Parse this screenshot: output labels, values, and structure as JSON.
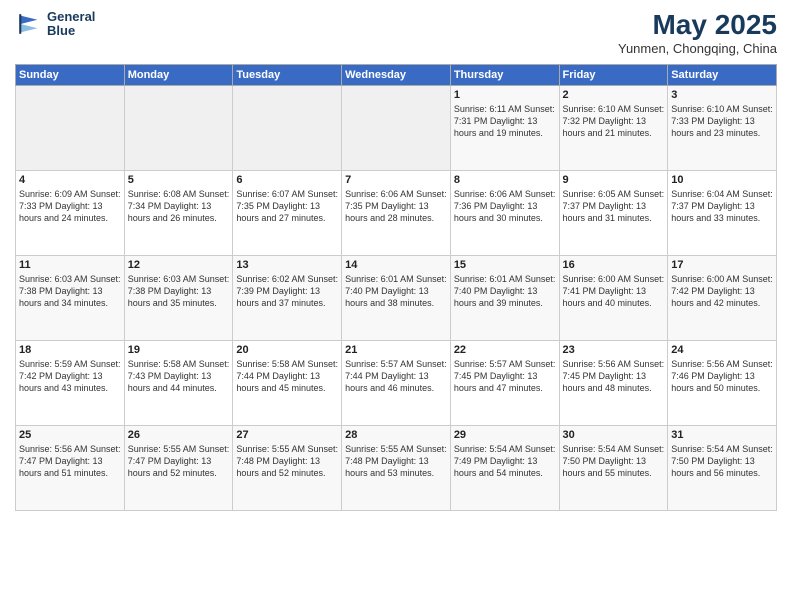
{
  "logo": {
    "line1": "General",
    "line2": "Blue"
  },
  "title": "May 2025",
  "subtitle": "Yunmen, Chongqing, China",
  "days_of_week": [
    "Sunday",
    "Monday",
    "Tuesday",
    "Wednesday",
    "Thursday",
    "Friday",
    "Saturday"
  ],
  "weeks": [
    [
      {
        "day": "",
        "info": ""
      },
      {
        "day": "",
        "info": ""
      },
      {
        "day": "",
        "info": ""
      },
      {
        "day": "",
        "info": ""
      },
      {
        "day": "1",
        "info": "Sunrise: 6:11 AM\nSunset: 7:31 PM\nDaylight: 13 hours\nand 19 minutes."
      },
      {
        "day": "2",
        "info": "Sunrise: 6:10 AM\nSunset: 7:32 PM\nDaylight: 13 hours\nand 21 minutes."
      },
      {
        "day": "3",
        "info": "Sunrise: 6:10 AM\nSunset: 7:33 PM\nDaylight: 13 hours\nand 23 minutes."
      }
    ],
    [
      {
        "day": "4",
        "info": "Sunrise: 6:09 AM\nSunset: 7:33 PM\nDaylight: 13 hours\nand 24 minutes."
      },
      {
        "day": "5",
        "info": "Sunrise: 6:08 AM\nSunset: 7:34 PM\nDaylight: 13 hours\nand 26 minutes."
      },
      {
        "day": "6",
        "info": "Sunrise: 6:07 AM\nSunset: 7:35 PM\nDaylight: 13 hours\nand 27 minutes."
      },
      {
        "day": "7",
        "info": "Sunrise: 6:06 AM\nSunset: 7:35 PM\nDaylight: 13 hours\nand 28 minutes."
      },
      {
        "day": "8",
        "info": "Sunrise: 6:06 AM\nSunset: 7:36 PM\nDaylight: 13 hours\nand 30 minutes."
      },
      {
        "day": "9",
        "info": "Sunrise: 6:05 AM\nSunset: 7:37 PM\nDaylight: 13 hours\nand 31 minutes."
      },
      {
        "day": "10",
        "info": "Sunrise: 6:04 AM\nSunset: 7:37 PM\nDaylight: 13 hours\nand 33 minutes."
      }
    ],
    [
      {
        "day": "11",
        "info": "Sunrise: 6:03 AM\nSunset: 7:38 PM\nDaylight: 13 hours\nand 34 minutes."
      },
      {
        "day": "12",
        "info": "Sunrise: 6:03 AM\nSunset: 7:38 PM\nDaylight: 13 hours\nand 35 minutes."
      },
      {
        "day": "13",
        "info": "Sunrise: 6:02 AM\nSunset: 7:39 PM\nDaylight: 13 hours\nand 37 minutes."
      },
      {
        "day": "14",
        "info": "Sunrise: 6:01 AM\nSunset: 7:40 PM\nDaylight: 13 hours\nand 38 minutes."
      },
      {
        "day": "15",
        "info": "Sunrise: 6:01 AM\nSunset: 7:40 PM\nDaylight: 13 hours\nand 39 minutes."
      },
      {
        "day": "16",
        "info": "Sunrise: 6:00 AM\nSunset: 7:41 PM\nDaylight: 13 hours\nand 40 minutes."
      },
      {
        "day": "17",
        "info": "Sunrise: 6:00 AM\nSunset: 7:42 PM\nDaylight: 13 hours\nand 42 minutes."
      }
    ],
    [
      {
        "day": "18",
        "info": "Sunrise: 5:59 AM\nSunset: 7:42 PM\nDaylight: 13 hours\nand 43 minutes."
      },
      {
        "day": "19",
        "info": "Sunrise: 5:58 AM\nSunset: 7:43 PM\nDaylight: 13 hours\nand 44 minutes."
      },
      {
        "day": "20",
        "info": "Sunrise: 5:58 AM\nSunset: 7:44 PM\nDaylight: 13 hours\nand 45 minutes."
      },
      {
        "day": "21",
        "info": "Sunrise: 5:57 AM\nSunset: 7:44 PM\nDaylight: 13 hours\nand 46 minutes."
      },
      {
        "day": "22",
        "info": "Sunrise: 5:57 AM\nSunset: 7:45 PM\nDaylight: 13 hours\nand 47 minutes."
      },
      {
        "day": "23",
        "info": "Sunrise: 5:56 AM\nSunset: 7:45 PM\nDaylight: 13 hours\nand 48 minutes."
      },
      {
        "day": "24",
        "info": "Sunrise: 5:56 AM\nSunset: 7:46 PM\nDaylight: 13 hours\nand 50 minutes."
      }
    ],
    [
      {
        "day": "25",
        "info": "Sunrise: 5:56 AM\nSunset: 7:47 PM\nDaylight: 13 hours\nand 51 minutes."
      },
      {
        "day": "26",
        "info": "Sunrise: 5:55 AM\nSunset: 7:47 PM\nDaylight: 13 hours\nand 52 minutes."
      },
      {
        "day": "27",
        "info": "Sunrise: 5:55 AM\nSunset: 7:48 PM\nDaylight: 13 hours\nand 52 minutes."
      },
      {
        "day": "28",
        "info": "Sunrise: 5:55 AM\nSunset: 7:48 PM\nDaylight: 13 hours\nand 53 minutes."
      },
      {
        "day": "29",
        "info": "Sunrise: 5:54 AM\nSunset: 7:49 PM\nDaylight: 13 hours\nand 54 minutes."
      },
      {
        "day": "30",
        "info": "Sunrise: 5:54 AM\nSunset: 7:50 PM\nDaylight: 13 hours\nand 55 minutes."
      },
      {
        "day": "31",
        "info": "Sunrise: 5:54 AM\nSunset: 7:50 PM\nDaylight: 13 hours\nand 56 minutes."
      }
    ]
  ]
}
